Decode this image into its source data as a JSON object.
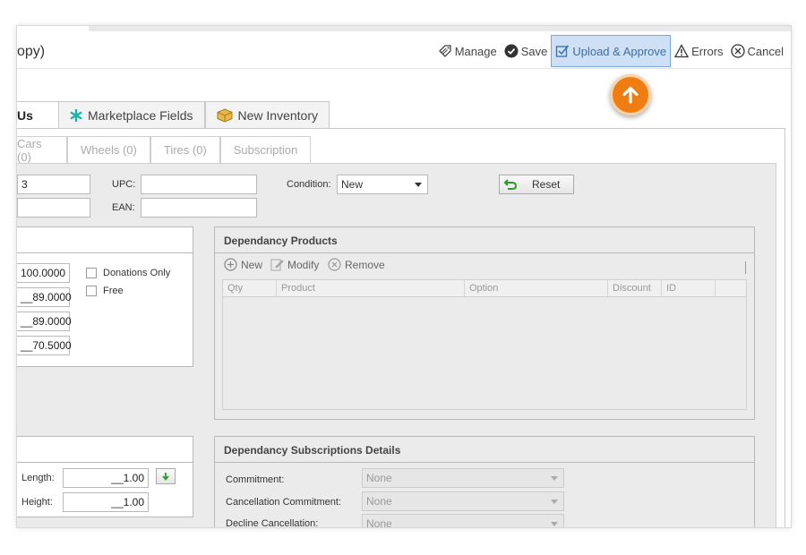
{
  "title": "opy)",
  "toolbar": {
    "manage": "Manage",
    "save": "Save",
    "upload_approve": "Upload & Approve",
    "errors": "Errors",
    "cancel": "Cancel"
  },
  "main_tabs": {
    "us": "Us",
    "marketplace_fields": "Marketplace Fields",
    "new_inventory": "New Inventory"
  },
  "sub_tabs": {
    "cars": "Cars (0)",
    "wheels": "Wheels (0)",
    "tires": "Tires (0)",
    "subscription": "Subscription"
  },
  "form": {
    "field1_value": "3",
    "field2_value": "",
    "upc_label": "UPC:",
    "upc_value": "",
    "ean_label": "EAN:",
    "ean_value": "",
    "condition_label": "Condition:",
    "condition_value": "New",
    "reset_label": "Reset"
  },
  "prices": {
    "p1": "100.0000",
    "p2": "__89.0000",
    "p3": "__89.0000",
    "p4": "__70.5000",
    "donations_only": "Donations Only",
    "free": "Free"
  },
  "dependency_products": {
    "title": "Dependancy Products",
    "new": "New",
    "modify": "Modify",
    "remove": "Remove",
    "columns": [
      "Qty",
      "Product",
      "Option",
      "Discount",
      "ID",
      ""
    ]
  },
  "dimensions": {
    "length_label": "Length:",
    "length_value": "__1.00",
    "height_label": "Height:",
    "height_value": "__1.00"
  },
  "dependency_subscriptions": {
    "title": "Dependancy Subscriptions Details",
    "commitment_label": "Commitment:",
    "commitment_value": "None",
    "cancellation_label": "Cancellation Commitment:",
    "cancellation_value": "None",
    "decline_label": "Decline Cancellation:",
    "decline_value": "None"
  },
  "colors": {
    "accent": "#f07d12",
    "active_button_bg": "#cde0f5",
    "marketplace_icon": "#1bb3a4"
  }
}
